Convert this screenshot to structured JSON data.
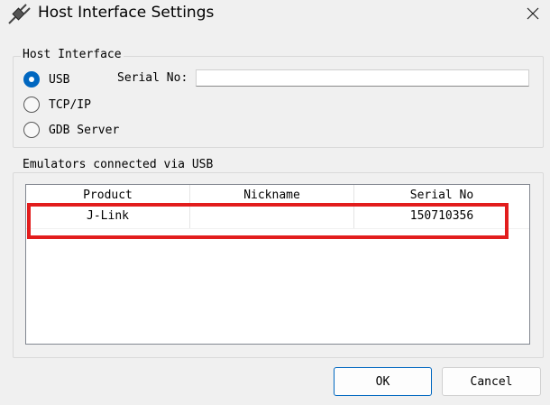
{
  "window": {
    "title": "Host Interface Settings"
  },
  "host_interface": {
    "group_title": "Host Interface",
    "options": [
      {
        "label": "USB",
        "checked": true
      },
      {
        "label": "TCP/IP",
        "checked": false
      },
      {
        "label": "GDB Server",
        "checked": false
      }
    ],
    "serial_label": "Serial No:",
    "serial_value": ""
  },
  "emulators": {
    "group_title": "Emulators connected via USB",
    "columns": [
      "Product",
      "Nickname",
      "Serial No"
    ],
    "rows": [
      {
        "product": "J-Link",
        "nickname": "",
        "serial": "150710356"
      }
    ]
  },
  "buttons": {
    "ok": "OK",
    "cancel": "Cancel"
  },
  "colors": {
    "highlight": "#e21d1d",
    "accent": "#0067c0"
  }
}
